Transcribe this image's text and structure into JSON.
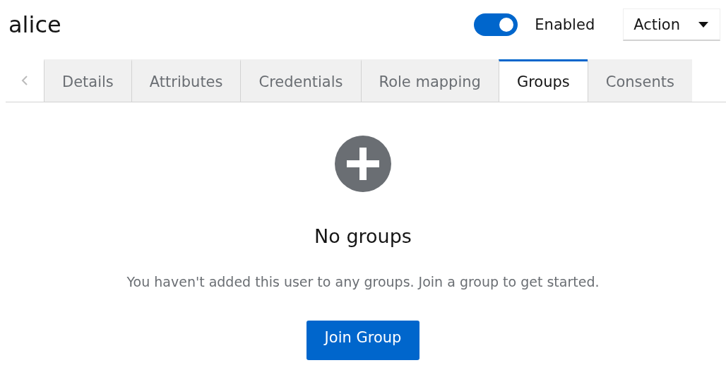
{
  "header": {
    "title": "alice",
    "toggle": {
      "label": "Enabled",
      "on": true
    },
    "action": {
      "label": "Action"
    }
  },
  "tabs": [
    {
      "label": "Details",
      "selected": false
    },
    {
      "label": "Attributes",
      "selected": false
    },
    {
      "label": "Credentials",
      "selected": false
    },
    {
      "label": "Role mapping",
      "selected": false
    },
    {
      "label": "Groups",
      "selected": true
    },
    {
      "label": "Consents",
      "selected": false
    }
  ],
  "empty_state": {
    "title": "No groups",
    "message": "You haven't added this user to any groups. Join a group to get started.",
    "button": "Join Group"
  }
}
